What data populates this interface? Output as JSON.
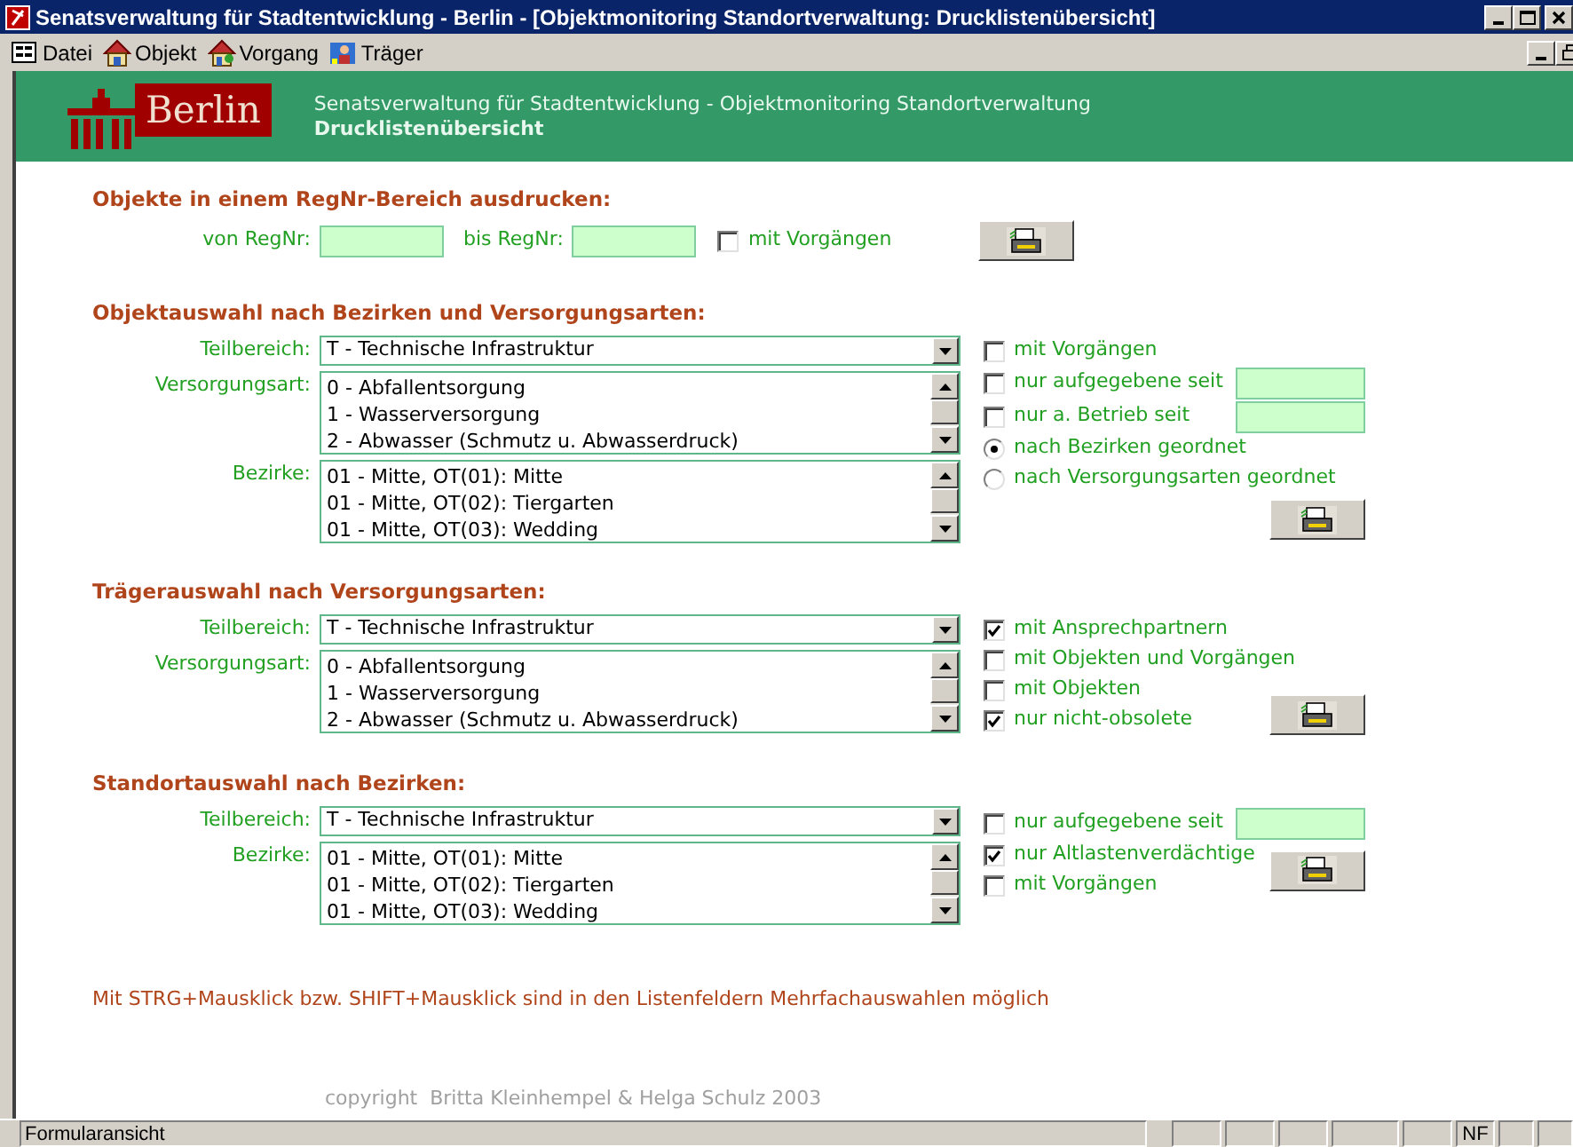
{
  "window": {
    "title": "Senatsverwaltung für Stadtentwicklung - Berlin - [Objektmonitoring Standortverwaltung: Drucklistenübersicht]"
  },
  "menu": [
    {
      "label": "Datei",
      "kind": "form"
    },
    {
      "label": "Objekt",
      "kind": "house"
    },
    {
      "label": "Vorgang",
      "kind": "houses"
    },
    {
      "label": "Träger",
      "kind": "person"
    }
  ],
  "header": {
    "logo_text": "Berlin",
    "subtitle": "Senatsverwaltung für Stadtentwicklung - Objektmonitoring Standortverwaltung",
    "title": "Drucklistenübersicht"
  },
  "sections": [
    {
      "kind": "range",
      "heading": "Objekte in einem RegNr-Bereich ausdrucken:",
      "fields": [
        {
          "label": "von RegNr:"
        },
        {
          "label": "bis RegNr:"
        }
      ],
      "options": [
        {
          "kind": "checkbox",
          "label": "mit Vorgängen",
          "checked": false
        }
      ]
    },
    {
      "kind": "objects",
      "heading": "Objektauswahl nach Bezirken und Versorgungsarten:",
      "controls": [
        {
          "kind": "dropdown",
          "label": "Teilbereich:",
          "value": "T - Technische Infrastruktur"
        },
        {
          "kind": "list",
          "label": "Versorgungsart:",
          "items": [
            "0 - Abfallentsorgung",
            "1 - Wasserversorgung",
            "2 - Abwasser (Schmutz u. Abwasserdruck)"
          ]
        },
        {
          "kind": "list",
          "label": "Bezirke:",
          "items": [
            "01 - Mitte, OT(01): Mitte",
            "01 - Mitte, OT(02): Tiergarten",
            "01 - Mitte, OT(03): Wedding"
          ]
        }
      ],
      "options": [
        {
          "kind": "checkbox",
          "label": "mit Vorgängen",
          "checked": false
        },
        {
          "kind": "date_checkbox",
          "label": "nur aufgegebene seit",
          "checked": false
        },
        {
          "kind": "date_checkbox",
          "label": "nur a. Betrieb seit",
          "checked": false
        },
        {
          "kind": "radio",
          "label": "nach Bezirken geordnet",
          "selected": true
        },
        {
          "kind": "radio",
          "label": "nach Versorgungsarten geordnet",
          "selected": false
        }
      ]
    },
    {
      "kind": "carriers",
      "heading": "Trägerauswahl nach Versorgungsarten:",
      "controls": [
        {
          "kind": "dropdown",
          "label": "Teilbereich:",
          "value": "T - Technische Infrastruktur"
        },
        {
          "kind": "list",
          "label": "Versorgungsart:",
          "items": [
            "0 - Abfallentsorgung",
            "1 - Wasserversorgung",
            "2 - Abwasser (Schmutz u. Abwasserdruck)"
          ]
        }
      ],
      "options": [
        {
          "kind": "checkbox",
          "label": "mit Ansprechpartnern",
          "checked": true
        },
        {
          "kind": "checkbox",
          "label": "mit Objekten und Vorgängen",
          "checked": false
        },
        {
          "kind": "checkbox",
          "label": "mit Objekten",
          "checked": false
        },
        {
          "kind": "checkbox",
          "label": "nur nicht-obsolete",
          "checked": true
        }
      ]
    },
    {
      "kind": "locations",
      "heading": "Standortauswahl nach Bezirken:",
      "controls": [
        {
          "kind": "dropdown",
          "label": "Teilbereich:",
          "value": "T - Technische Infrastruktur"
        },
        {
          "kind": "list",
          "label": "Bezirke:",
          "items": [
            "01 - Mitte, OT(01): Mitte",
            "01 - Mitte, OT(02): Tiergarten",
            "01 - Mitte, OT(03): Wedding"
          ]
        }
      ],
      "options": [
        {
          "kind": "date_checkbox",
          "label": "nur aufgegebene seit",
          "checked": false
        },
        {
          "kind": "checkbox",
          "label": "nur Altlastenverdächtige",
          "checked": true
        },
        {
          "kind": "checkbox",
          "label": "mit Vorgängen",
          "checked": false
        }
      ]
    }
  ],
  "note": "Mit STRG+Mausklick bzw. SHIFT+Mausklick sind in den Listenfeldern Mehrfachauswahlen möglich",
  "copyright": "copyright  Britta Kleinhempel & Helga Schulz 2003",
  "status_bar": {
    "text": "Formularansicht",
    "indicators": [
      "NF"
    ]
  }
}
